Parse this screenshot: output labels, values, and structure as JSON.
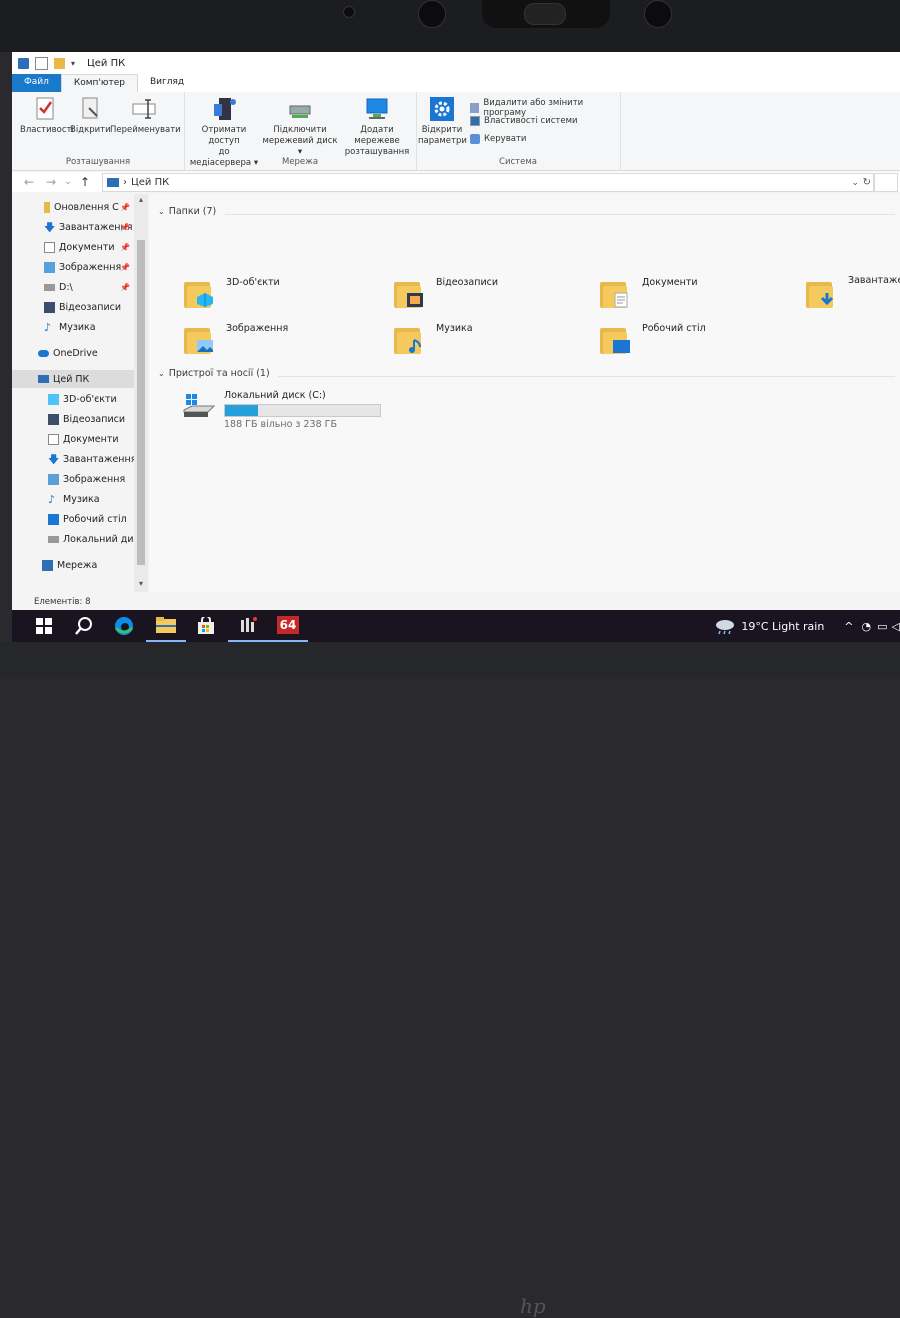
{
  "window": {
    "title": "Цей ПК"
  },
  "tabs": [
    {
      "label": "Файл"
    },
    {
      "label": "Комп'ютер"
    },
    {
      "label": "Вигляд"
    }
  ],
  "ribbon": {
    "location": {
      "label": "Розташування",
      "properties": "Властивості",
      "open": "Відкрити",
      "rename": "Перейменувати"
    },
    "network": {
      "label": "Мережа",
      "media_line1": "Отримати доступ",
      "media_line2": "до медіасервера",
      "map_line1": "Підключити",
      "map_line2": "мережевий диск",
      "add_line1": "Додати мережеве",
      "add_line2": "розташування"
    },
    "system": {
      "label": "Система",
      "open_settings_line1": "Відкрити",
      "open_settings_line2": "параметри",
      "uninstall": "Видалити або змінити програму",
      "system_properties": "Властивості системи",
      "manage": "Керувати"
    }
  },
  "address": {
    "path": "Цей ПК"
  },
  "nav": {
    "quick": [
      {
        "label": "Оновлення С"
      },
      {
        "label": "Завантаження"
      },
      {
        "label": "Документи"
      },
      {
        "label": "Зображення"
      },
      {
        "label": "D:\\"
      },
      {
        "label": "Відеозаписи"
      },
      {
        "label": "Музика"
      }
    ],
    "onedrive": "OneDrive",
    "thispc": "Цей ПК",
    "thispc_items": [
      {
        "label": "3D-об'єкти"
      },
      {
        "label": "Відеозаписи"
      },
      {
        "label": "Документи"
      },
      {
        "label": "Завантаження"
      },
      {
        "label": "Зображення"
      },
      {
        "label": "Музика"
      },
      {
        "label": "Робочий стіл"
      },
      {
        "label": "Локальний диск"
      }
    ],
    "network": "Мережа"
  },
  "content": {
    "folders_header": "Папки (7)",
    "folders": [
      {
        "label": "3D-об'єкти"
      },
      {
        "label": "Відеозаписи"
      },
      {
        "label": "Документи"
      },
      {
        "label": "Завантаження"
      },
      {
        "label": "Зображення"
      },
      {
        "label": "Музика"
      },
      {
        "label": "Робочий стіл"
      }
    ],
    "devices_header": "Пристрої та носії (1)",
    "drive": {
      "label": "Локальний диск (C:)",
      "free": "188 ГБ вільно з 238 ГБ",
      "used_fraction": 0.21
    }
  },
  "status": {
    "items": "Елементів: 8"
  },
  "taskbar": {
    "weather": "19°C  Light rain",
    "app_badge": "64"
  }
}
